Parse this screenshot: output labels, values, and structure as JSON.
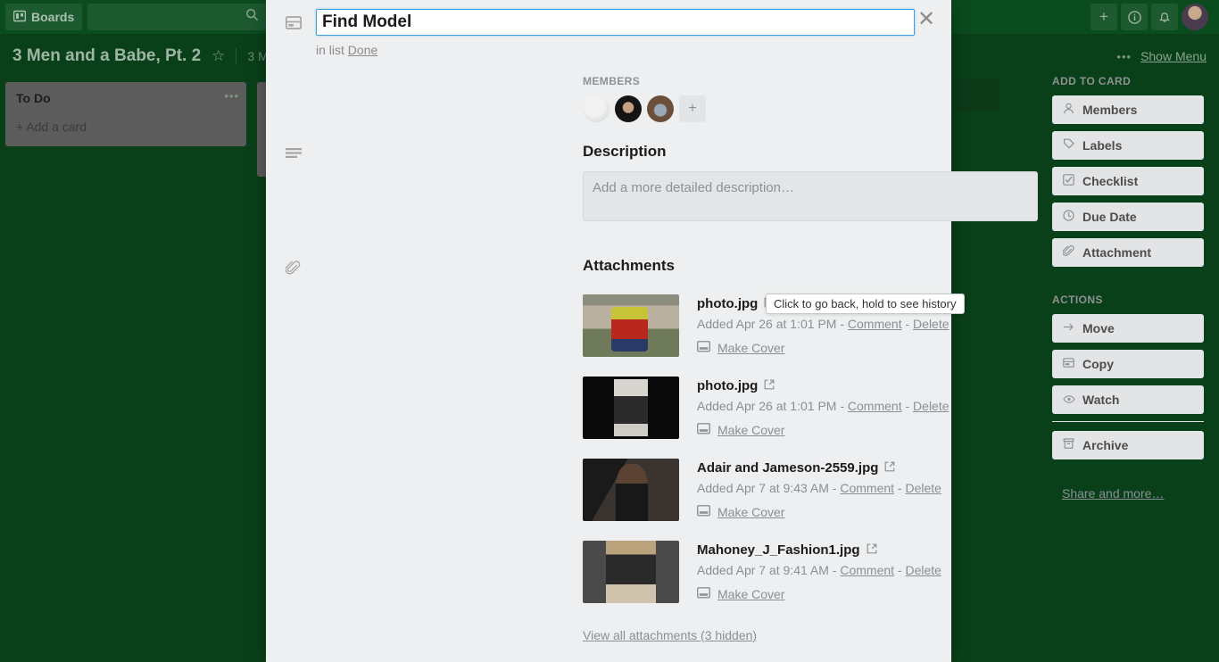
{
  "top_nav": {
    "boards_label": "Boards",
    "boards_icon": "board-icon",
    "search_placeholder": "",
    "search_value": "",
    "search_icon": "search-icon",
    "add_icon": "plus-icon",
    "info_icon": "info-icon",
    "notifications_icon": "bell-icon",
    "avatar": "user-avatar"
  },
  "board_header": {
    "title": "3 Men and a Babe, Pt. 2",
    "star_icon": "star-icon",
    "team": "3 M",
    "more_icon": "ellipsis-icon",
    "show_menu": "Show Menu"
  },
  "board": {
    "lists": [
      {
        "title": "To Do",
        "add_card": "+ Add a card",
        "menu_icon": "list-menu-icon"
      }
    ]
  },
  "card": {
    "close_icon": "close-icon",
    "card_icon": "card-icon",
    "title": "Find Model",
    "in_list_prefix": "in list",
    "in_list_name": "Done",
    "members": {
      "label": "MEMBERS",
      "avatars": [
        "member-avatar-1",
        "member-avatar-2",
        "member-avatar-3"
      ],
      "add_label": "+"
    },
    "description": {
      "icon": "description-icon",
      "heading": "Description",
      "placeholder": "Add a more detailed description…"
    },
    "attachments": {
      "icon": "paperclip-icon",
      "heading": "Attachments",
      "view_all": "View all attachments (3 hidden)",
      "make_cover_label": "Make Cover",
      "make_cover_icon": "cover-icon",
      "external_link_icon": "external-link-icon",
      "items": [
        {
          "name": "photo.jpg",
          "added": "Added Apr 26 at 1:01 PM",
          "separator": "-",
          "comment": "Comment",
          "delete": "Delete",
          "make_cover": "Make Cover",
          "thumb": "photo-thumb-1"
        },
        {
          "name": "photo.jpg",
          "added": "Added Apr 26 at 1:01 PM",
          "separator": "-",
          "comment": "Comment",
          "delete": "Delete",
          "make_cover": "Make Cover",
          "thumb": "photo-thumb-2"
        },
        {
          "name": "Adair and Jameson-2559.jpg",
          "added": "Added Apr 7 at 9:43 AM",
          "separator": "-",
          "comment": "Comment",
          "delete": "Delete",
          "make_cover": "Make Cover",
          "thumb": "photo-thumb-3"
        },
        {
          "name": "Mahoney_J_Fashion1.jpg",
          "added": "Added Apr 7 at 9:41 AM",
          "separator": "-",
          "comment": "Comment",
          "delete": "Delete",
          "make_cover": "Make Cover",
          "thumb": "photo-thumb-4"
        }
      ]
    },
    "tooltip": "Click to go back, hold to see history",
    "sidebar": {
      "add_to_card_label": "ADD TO CARD",
      "add_to_card": [
        {
          "label": "Members",
          "icon": "person-icon"
        },
        {
          "label": "Labels",
          "icon": "label-icon"
        },
        {
          "label": "Checklist",
          "icon": "checklist-icon"
        },
        {
          "label": "Due Date",
          "icon": "clock-icon"
        },
        {
          "label": "Attachment",
          "icon": "paperclip-icon"
        }
      ],
      "actions_label": "ACTIONS",
      "actions": [
        {
          "label": "Move",
          "icon": "arrow-right-icon"
        },
        {
          "label": "Copy",
          "icon": "copy-icon"
        },
        {
          "label": "Watch",
          "icon": "eye-icon"
        }
      ],
      "archive": {
        "label": "Archive",
        "icon": "archive-icon"
      },
      "share_and_more": "Share and more…"
    }
  },
  "colors": {
    "board_bg": "#0a4019",
    "nav_bg": "#0b4c1f",
    "modal_bg": "#edeff0",
    "button_bg": "#e2e4e6",
    "focus_border": "#3c9ee5",
    "muted_text": "#8a8f94"
  }
}
